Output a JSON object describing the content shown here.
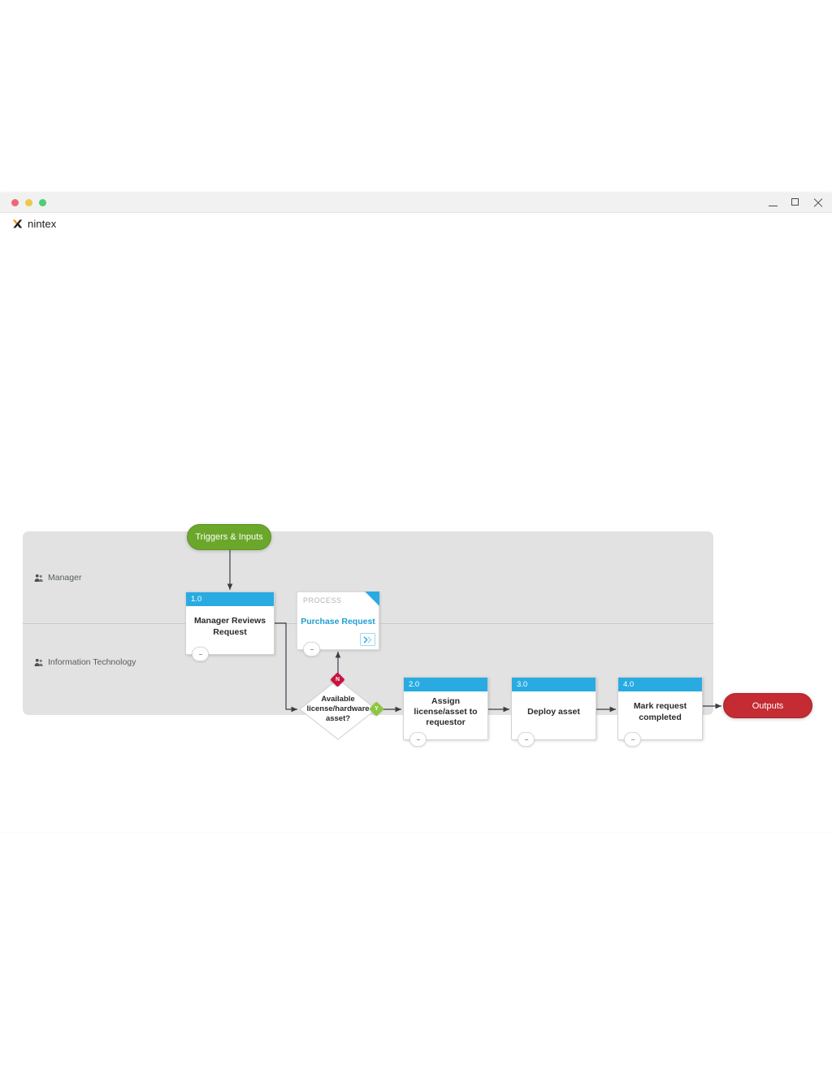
{
  "window": {
    "traffic_lights": [
      "close",
      "minimize",
      "maximize"
    ],
    "controls": {
      "minimize": "minimize",
      "maximize": "maximize",
      "close": "close"
    }
  },
  "brand": {
    "logo_icon": "nintex-x-icon",
    "name": "nintex",
    "logo_color": "#f7941e"
  },
  "colors": {
    "node_header": "#29abe2",
    "process_link": "#1f9ed4",
    "trigger_green": "#6aa72a",
    "outputs_red": "#c42b33",
    "branch_no": "#c9133e",
    "branch_yes": "#8ec63f",
    "pool_background": "#e2e2e2"
  },
  "diagram": {
    "start": {
      "label": "Triggers & Inputs",
      "shape": "pill",
      "color": "#6aa72a"
    },
    "end": {
      "label": "Outputs",
      "shape": "pill",
      "color": "#c42b33"
    },
    "lanes": [
      {
        "id": "manager",
        "label": "Manager",
        "icon": "people-icon"
      },
      {
        "id": "it",
        "label": "Information Technology",
        "icon": "people-icon"
      }
    ],
    "nodes": [
      {
        "id": "1.0",
        "number": "1.0",
        "label": "Manager Reviews Request",
        "lane": "manager",
        "badge": "collapse-badge"
      },
      {
        "id": "2.0",
        "number": "2.0",
        "label": "Assign license/asset to requestor",
        "lane": "it",
        "badge": "collapse-badge"
      },
      {
        "id": "3.0",
        "number": "3.0",
        "label": "Deploy asset",
        "lane": "it",
        "badge": "collapse-badge"
      },
      {
        "id": "4.0",
        "number": "4.0",
        "label": "Mark request completed",
        "lane": "it",
        "badge": "collapse-badge"
      }
    ],
    "process_card": {
      "kicker": "PROCESS",
      "title": "Purchase Request",
      "lane": "manager",
      "open_icon": "open-external-icon",
      "badge": "collapse-badge"
    },
    "decision": {
      "label": "Available license/hardware asset?",
      "lane": "it",
      "branches": [
        {
          "key": "N",
          "label": "N",
          "color": "#c9133e",
          "direction": "up",
          "target": "Purchase Request"
        },
        {
          "key": "Y",
          "label": "Y",
          "color": "#8ec63f",
          "direction": "right",
          "target": "2.0"
        }
      ]
    }
  }
}
